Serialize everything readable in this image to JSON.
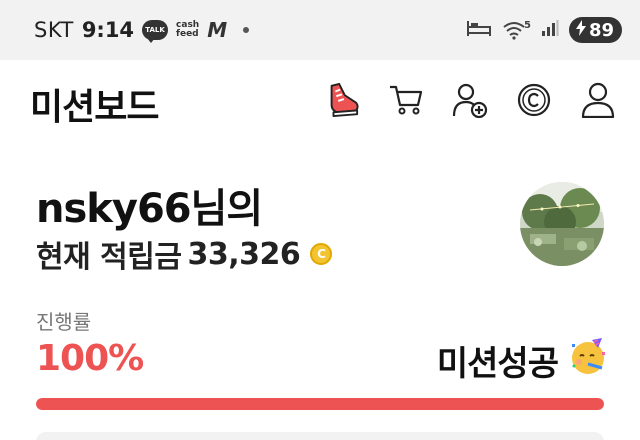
{
  "status_bar": {
    "carrier": "SKT",
    "time": "9:14",
    "talk_label": "TALK",
    "cashfeed_line1": "cash",
    "cashfeed_line2": "feed",
    "m_label": "M",
    "wifi_label": "5",
    "battery": "89"
  },
  "header": {
    "title": "미션보드",
    "icons": [
      "sneaker-icon",
      "cart-icon",
      "add-friend-icon",
      "coin-icon",
      "profile-icon"
    ]
  },
  "greeting": {
    "name_line": "nsky66님의",
    "points_label": "현재 적립금",
    "points_value": "33,326",
    "coin_symbol": "C"
  },
  "progress": {
    "label": "진행률",
    "value_text": "100%",
    "value": 1.0,
    "status": "미션성공",
    "emoji": "🥳"
  },
  "colors": {
    "accent": "#ee5353",
    "coin": "#f4c430",
    "status_bar_bg": "#f2f2f2"
  }
}
